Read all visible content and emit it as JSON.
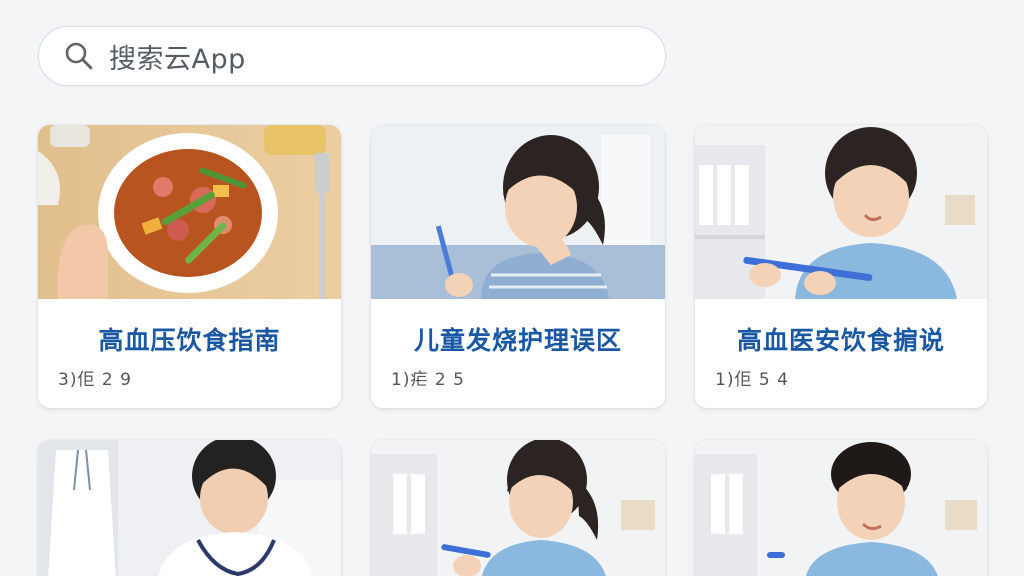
{
  "search": {
    "placeholder": "搜索云App",
    "icon": "search-icon"
  },
  "articles": [
    {
      "title": "高血压饮食指南",
      "meta": "3)佢 2 9"
    },
    {
      "title": "儿童发烧护理误区",
      "meta": "1)疟 2 5"
    },
    {
      "title": "高血医安饮食掮说",
      "meta": "1)佢 5 4"
    },
    {
      "title": "",
      "meta": ""
    },
    {
      "title": "",
      "meta": ""
    },
    {
      "title": "",
      "meta": ""
    }
  ],
  "colors": {
    "title": "#1a58a3",
    "background": "#f4f5f7",
    "card": "#ffffff"
  }
}
